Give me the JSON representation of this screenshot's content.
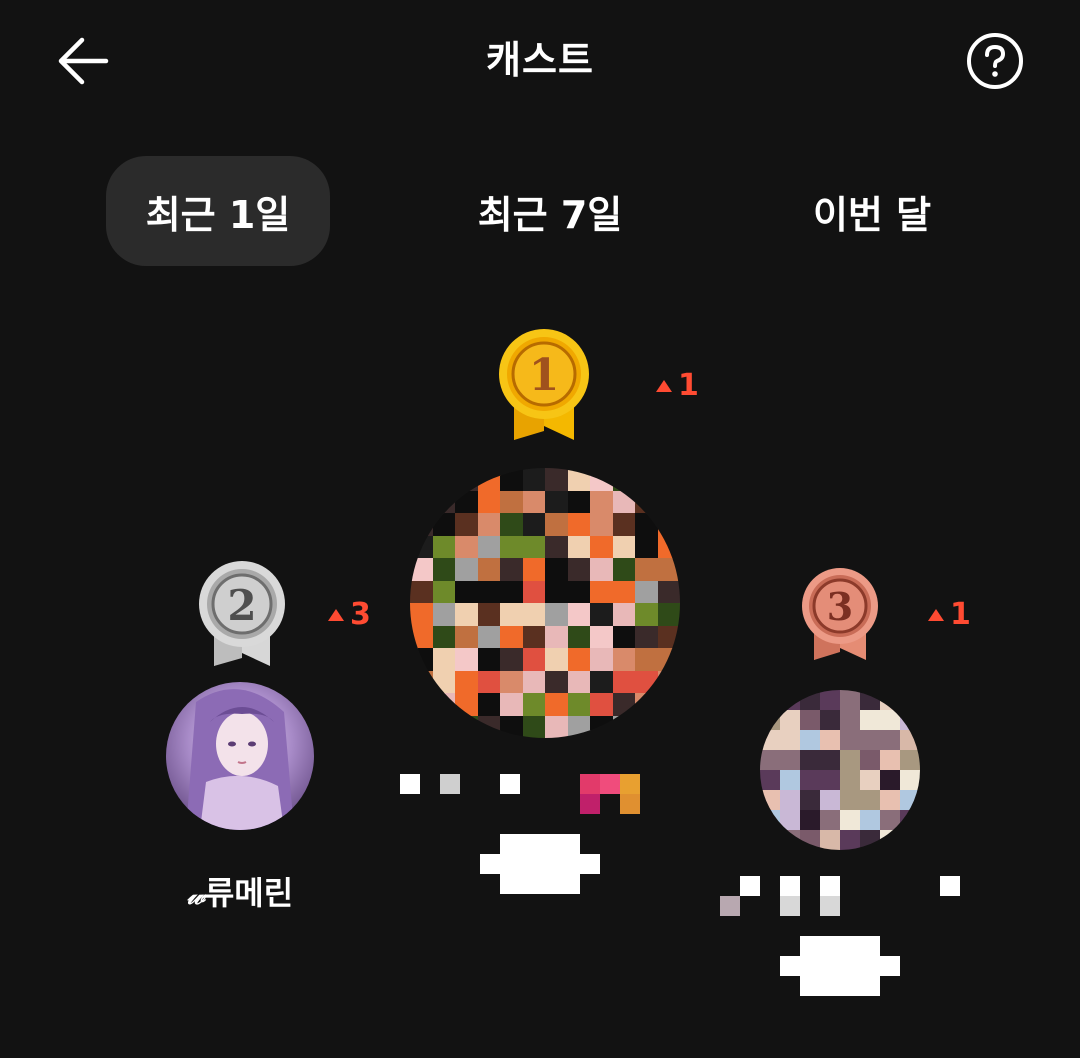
{
  "header": {
    "title": "캐스트",
    "back_icon": "arrow-left-icon",
    "help_icon": "question-circle-icon"
  },
  "tabs": [
    {
      "label": "최근 1일",
      "active": true
    },
    {
      "label": "최근 7일",
      "active": false
    },
    {
      "label": "이번 달",
      "active": false
    }
  ],
  "ranking": [
    {
      "rank": 1,
      "medal": "gold",
      "medal_number": "1",
      "change": "1",
      "change_direction": "up",
      "nickname": ""
    },
    {
      "rank": 2,
      "medal": "silver",
      "medal_number": "2",
      "change": "3",
      "change_direction": "up",
      "nickname": "류메린",
      "nickname_prefix": "𝓌"
    },
    {
      "rank": 3,
      "medal": "bronze",
      "medal_number": "3",
      "change": "1",
      "change_direction": "up",
      "nickname": ""
    }
  ],
  "colors": {
    "background": "#121212",
    "active_tab": "#2b2b2b",
    "rank_up": "#ff4b32",
    "gold": "#f2b400",
    "silver": "#c9c9c9",
    "bronze": "#e07f6a"
  }
}
